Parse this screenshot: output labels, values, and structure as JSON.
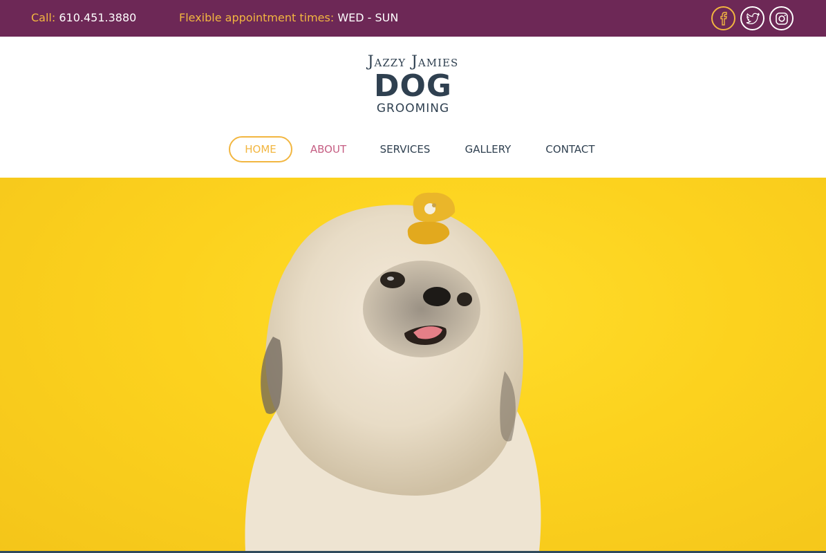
{
  "topbar": {
    "call_label": "Call:",
    "phone": "610.451.3880",
    "appointment_label": "Flexible appointment times:",
    "appointment_days": "WED - SUN",
    "social": [
      "facebook-icon",
      "twitter-icon",
      "instagram-icon"
    ]
  },
  "logo": {
    "script": "Jazzy Jamies",
    "main": "DOG",
    "sub": "GROOMING"
  },
  "nav": {
    "items": [
      {
        "label": "HOME"
      },
      {
        "label": "ABOUT"
      },
      {
        "label": "SERVICES"
      },
      {
        "label": "GALLERY"
      },
      {
        "label": "CONTACT"
      }
    ]
  },
  "colors": {
    "topbar": "#6d2856",
    "accent": "#f2b640",
    "about": "#c55d82",
    "text": "#2f4050",
    "hero": "#fcd21e"
  },
  "hero": {
    "image": "shih-tzu-dog-photo"
  }
}
